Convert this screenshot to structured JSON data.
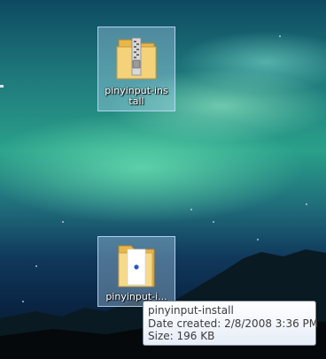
{
  "desktop": {
    "icons": [
      {
        "label": "pinyinput-ins\ntall",
        "icon": "zip-folder-icon",
        "selected": true
      },
      {
        "label": "pinyinput-i...",
        "icon": "folder-icon",
        "selected": true
      }
    ]
  },
  "tooltip": {
    "name": "pinyinput-install",
    "date_created": "Date created: 2/8/2008 3:36 PM",
    "size": "Size: 196 KB"
  }
}
